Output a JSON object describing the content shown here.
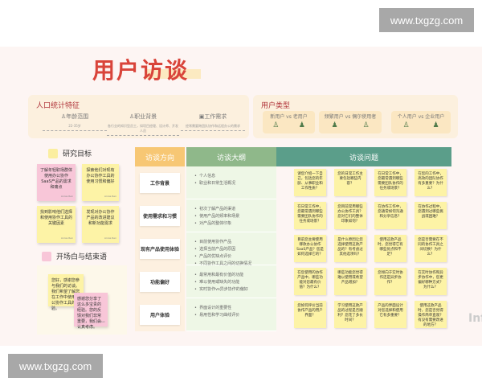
{
  "watermark": "www.txgzg.com",
  "title": "用户访谈",
  "demographics": {
    "title": "人口统计特征",
    "items": [
      {
        "label": "年龄范围",
        "icon": "person-icon",
        "value": "22-35岁"
      },
      {
        "label": "职业背景",
        "icon": "user-icon",
        "value": "各行业的知识型员工，如项目经理、设计师、开发人员"
      },
      {
        "label": "工作需求",
        "icon": "monitor-icon",
        "value": "经常需要跨团队协作和远程办公的需求"
      }
    ]
  },
  "user_types": {
    "title": "用户类型",
    "items": [
      {
        "label": "新用户 vs 老用户"
      },
      {
        "label": "频繁用户 vs 偶尔使用者"
      },
      {
        "label": "个人用户 vs 企业用户"
      }
    ]
  },
  "goals": {
    "title": "研究目标",
    "notes": [
      "了解年轻职场群体使用办公协作SaaS产品的需求和痛点",
      "探索他们对现有办公协作工具的使用习惯和偏好",
      "找到影响他们选择和使用协作工具的关键因素",
      "发现对办公协作产品的改进建议和新功能需求"
    ],
    "signature": "Annie Ren"
  },
  "opening": {
    "title": "开场白与结束语",
    "notes": [
      "您好，感谢您参与我们的访谈。我们希望了解您在工作中使用办公协作工具的体验。",
      "感谢您分享了这么多宝贵的经验。您的反馈对我们非常重要，我们会认真考虑。"
    ],
    "signature": "Annie Ren"
  },
  "table": {
    "headers": [
      "访谈方向",
      "访谈大纲",
      "访谈问题"
    ],
    "rows": [
      {
        "direction": "工作背景",
        "outline": [
          "个人信息",
          "职业和日常生活概况"
        ],
        "questions": [
          "请您介绍一下自己，包括您的年龄、从事职业和工作性质？",
          "您的日常工作主要包括哪些内容？",
          "在日常工作中，您最常遇到哪些需要团队协作的任务或场景？",
          "在您的工作中，高效的团队协作有多重要？为什么？"
        ]
      },
      {
        "direction": "使用需求和习惯",
        "outline": [
          "初次了解产品的渠道",
          "使用产品的频率和场景",
          "对产品的整体印象"
        ],
        "questions": [
          "在日常工作中，您最常遇到哪些需要团队协作的任务或场景？",
          "您目前常用哪些办公协作工具？您对它们的整体印象如何？",
          "在协作工作中，您通常如何沟通和分享信息？",
          "在协作过程中，您遇到过哪些挑战或困难？"
        ]
      },
      {
        "direction": "现有产品使用体验",
        "outline": [
          "目前使用协作产品",
          "选择当前产品的原因",
          "产品的优缺点评价",
          "不同协作工具之间的切换情况"
        ],
        "questions": [
          "目前您主要使用哪款办公协作SaaS产品？您是如何选择它的？",
          "是什么原因让您选择使用这款产品的？有考虑过其他选项吗？",
          "使用这款产品时，您觉得它有哪些优点和不足？",
          "您是否需要在不同的协作工具之间切换？为什么？"
        ]
      },
      {
        "direction": "功能偏好",
        "outline": [
          "最常用和最有价值的功能",
          "难以使用或缺失的功能",
          "实时协作vs异步协作的偏好"
        ],
        "questions": [
          "在您使用的协作产品中，哪些功能对您最有价值？为什么？",
          "哪些功能您觉得难以使用或希望产品增加？",
          "您倾向于实时协作还是异步协作？",
          "在实时协作和异步协作中，您更偏好哪种方式？为什么？"
        ]
      },
      {
        "direction": "用户体验",
        "outline": [
          "界面设计的重要性",
          "易用性和学习曲线评价"
        ],
        "questions": [
          "您如何评价当前协作产品的用户界面？",
          "学习使用这款产品的过程是否顺利？您花了多长时间？",
          "产品的界面设计对您选择和使用它有多重要？",
          "使用这款产品时，您是否觉得操作简单直观？有没有需要改进的地方？"
        ]
      }
    ]
  },
  "corner_logo": "Infi",
  "colors": {
    "title": "#d9443a",
    "direction_header": "#f7c774",
    "outline_header": "#8fb88a",
    "questions_header": "#5b9e8a",
    "sticky_yellow": "#fdf3a6",
    "sticky_pink": "#f8c6d8"
  }
}
